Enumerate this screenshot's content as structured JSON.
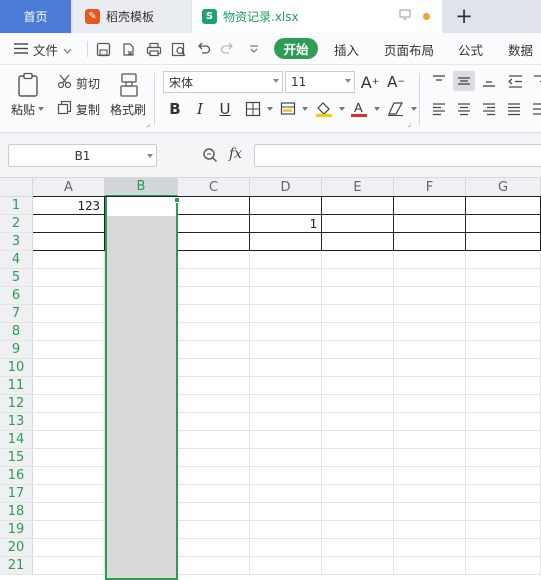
{
  "tabs": {
    "home": "首页",
    "template": "稻壳模板",
    "file": "物资记录.xlsx"
  },
  "menu": {
    "file": "文件",
    "items": [
      "开始",
      "插入",
      "页面布局",
      "公式",
      "数据"
    ]
  },
  "ribbon": {
    "paste": "粘贴",
    "cut": "剪切",
    "copy": "复制",
    "format_painter": "格式刷",
    "font_name": "宋体",
    "font_size": "11"
  },
  "formula_bar": {
    "name_box": "B1",
    "fx": "fx",
    "formula": ""
  },
  "grid": {
    "columns": [
      "A",
      "B",
      "C",
      "D",
      "E",
      "F",
      "G"
    ],
    "rows": [
      "1",
      "2",
      "3",
      "4",
      "5",
      "6",
      "7",
      "8",
      "9",
      "10",
      "11",
      "12",
      "13",
      "14",
      "15",
      "16",
      "17",
      "18",
      "19",
      "20",
      "21"
    ],
    "selected_column": "B",
    "cells": {
      "A1": "123",
      "D2": "1"
    }
  },
  "colors": {
    "accent": "#2e9c54",
    "home_tab": "#4a7bd6"
  }
}
